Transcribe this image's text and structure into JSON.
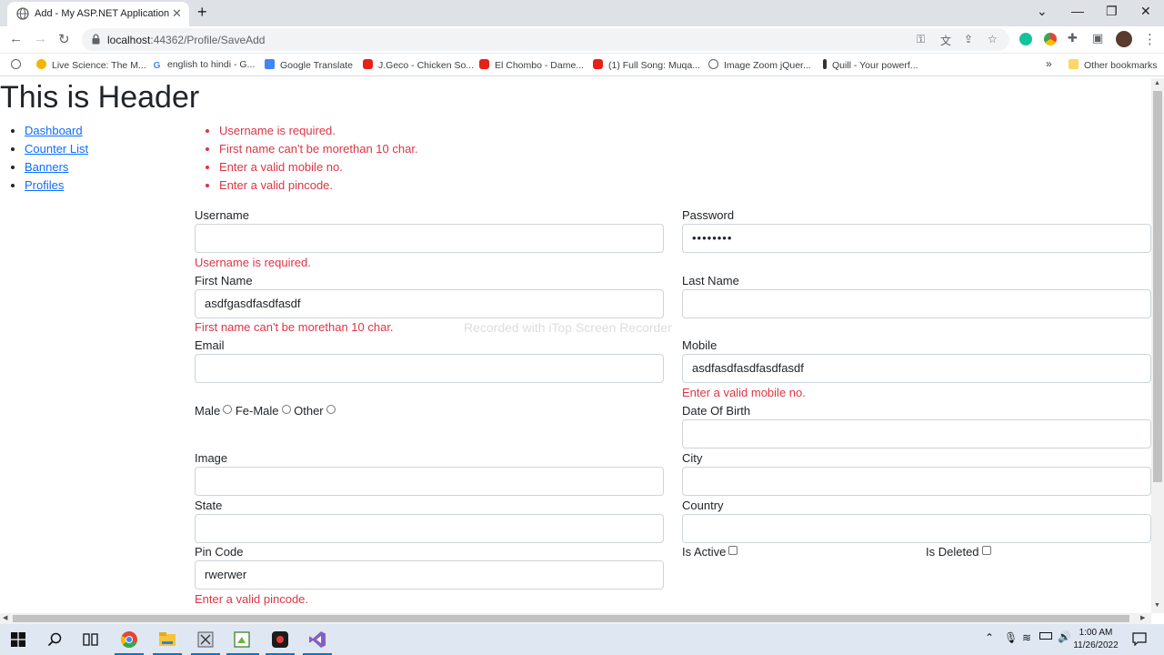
{
  "browser": {
    "tab_title": "Add - My ASP.NET Application",
    "url_host": "localhost",
    "url_path": ":44362/Profile/SaveAdd",
    "bookmarks": [
      "Live Science: The M...",
      "english to hindi - G...",
      "Google Translate",
      "J.Geco - Chicken So...",
      "El Chombo - Dame...",
      "(1) Full Song: Muqa...",
      "Image Zoom jQuer...",
      "Quill - Your powerf..."
    ],
    "more_bookmarks": "»",
    "other_bookmarks": "Other bookmarks"
  },
  "page": {
    "header": "This is Header",
    "nav": [
      "Dashboard",
      "Counter List",
      "Banners",
      "Profiles"
    ],
    "validation_summary": [
      "Username is required.",
      "First name can't be morethan 10 char.",
      "Enter a valid mobile no.",
      "Enter a valid pincode."
    ],
    "form": {
      "username_label": "Username",
      "username_value": "",
      "username_error": "Username is required.",
      "password_label": "Password",
      "password_value": "••••••••",
      "first_name_label": "First Name",
      "first_name_value": "asdfgasdfasdfasdf",
      "first_name_error": "First name can't be morethan 10 char.",
      "last_name_label": "Last Name",
      "last_name_value": "",
      "email_label": "Email",
      "email_value": "",
      "mobile_label": "Mobile",
      "mobile_value": "asdfasdfasdfasdfasdf",
      "mobile_error": "Enter a valid mobile no.",
      "gender_male": "Male",
      "gender_female": "Fe-Male",
      "gender_other": "Other",
      "dob_label": "Date Of Birth",
      "dob_value": "",
      "image_label": "Image",
      "city_label": "City",
      "city_value": "",
      "state_label": "State",
      "state_value": "",
      "country_label": "Country",
      "country_value": "",
      "pincode_label": "Pin Code",
      "pincode_value": "rwerwer",
      "pincode_error": "Enter a valid pincode.",
      "is_active_label": "Is Active",
      "is_deleted_label": "Is Deleted"
    },
    "watermark": "Recorded with iTop Screen Recorder"
  },
  "taskbar": {
    "time": "1:00 AM",
    "date": "11/26/2022"
  }
}
